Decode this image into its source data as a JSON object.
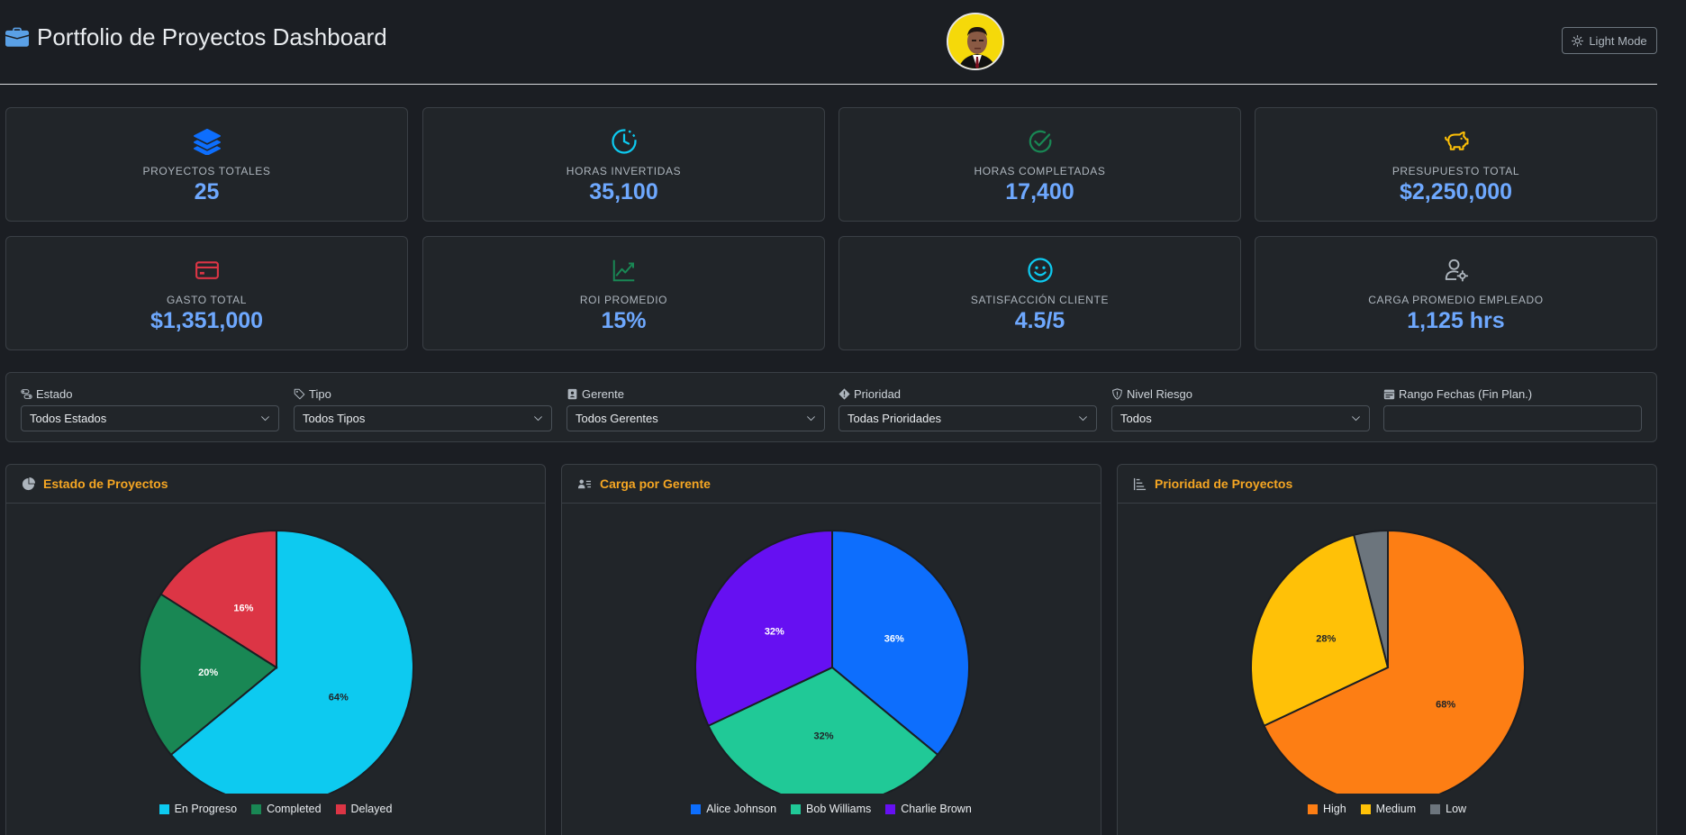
{
  "header": {
    "title": "Portfolio de Proyectos Dashboard",
    "light_mode_label": "Light Mode"
  },
  "kpis": [
    {
      "label": "PROYECTOS TOTALES",
      "value": "25",
      "icon": "layers-icon",
      "color": "#0d6efd"
    },
    {
      "label": "HORAS INVERTIDAS",
      "value": "35,100",
      "icon": "clock-icon",
      "color": "#0dcaf0"
    },
    {
      "label": "HORAS COMPLETADAS",
      "value": "17,400",
      "icon": "check-circle-icon",
      "color": "#198754"
    },
    {
      "label": "PRESUPUESTO TOTAL",
      "value": "$2,250,000",
      "icon": "piggy-bank-icon",
      "color": "#ffc107"
    },
    {
      "label": "GASTO TOTAL",
      "value": "$1,351,000",
      "icon": "credit-card-icon",
      "color": "#dc3545"
    },
    {
      "label": "ROI PROMEDIO",
      "value": "15%",
      "icon": "graph-up-icon",
      "color": "#198754"
    },
    {
      "label": "SATISFACCIÓN CLIENTE",
      "value": "4.5/5",
      "icon": "smile-icon",
      "color": "#0dcaf0"
    },
    {
      "label": "CARGA PROMEDIO EMPLEADO",
      "value": "1,125 hrs",
      "icon": "person-gear-icon",
      "color": "#adb5bd"
    }
  ],
  "filters": [
    {
      "label": "Estado",
      "value": "Todos Estados",
      "icon": "toggles-icon"
    },
    {
      "label": "Tipo",
      "value": "Todos Tipos",
      "icon": "tag-icon"
    },
    {
      "label": "Gerente",
      "value": "Todos Gerentes",
      "icon": "person-badge-icon"
    },
    {
      "label": "Prioridad",
      "value": "Todas Prioridades",
      "icon": "diamond-exclamation-icon"
    },
    {
      "label": "Nivel Riesgo",
      "value": "Todos",
      "icon": "shield-exclamation-icon"
    },
    {
      "label": "Rango Fechas (Fin Plan.)",
      "value": "",
      "icon": "calendar-range-icon"
    }
  ],
  "panels": [
    {
      "title": "Estado de Proyectos",
      "icon": "pie-chart-icon"
    },
    {
      "title": "Carga por Gerente",
      "icon": "person-lines-icon"
    },
    {
      "title": "Prioridad de Proyectos",
      "icon": "sort-icon"
    }
  ],
  "chart_data": [
    {
      "type": "pie",
      "title": "Estado de Proyectos",
      "categories": [
        "En Progreso",
        "Completed",
        "Delayed"
      ],
      "values": [
        64,
        20,
        16
      ],
      "labels": [
        "64%",
        "20%",
        "16%"
      ],
      "colors": [
        "#0dcaf0",
        "#198754",
        "#dc3545"
      ],
      "label_colors": [
        "#212529",
        "#ffffff",
        "#ffffff"
      ],
      "legend": "bottom"
    },
    {
      "type": "pie",
      "title": "Carga por Gerente",
      "categories": [
        "Alice Johnson",
        "Bob Williams",
        "Charlie Brown"
      ],
      "values": [
        36,
        32,
        32
      ],
      "labels": [
        "36%",
        "32%",
        "32%"
      ],
      "colors": [
        "#0d6efd",
        "#20c997",
        "#6610f2"
      ],
      "label_colors": [
        "#ffffff",
        "#212529",
        "#ffffff"
      ],
      "legend": "bottom"
    },
    {
      "type": "pie",
      "title": "Prioridad de Proyectos",
      "categories": [
        "High",
        "Medium",
        "Low"
      ],
      "values": [
        68,
        28,
        4
      ],
      "labels": [
        "68%",
        "28%",
        ""
      ],
      "colors": [
        "#fd7e14",
        "#ffc107",
        "#6c757d"
      ],
      "label_colors": [
        "#212529",
        "#212529",
        "#212529"
      ],
      "legend": "bottom"
    }
  ]
}
